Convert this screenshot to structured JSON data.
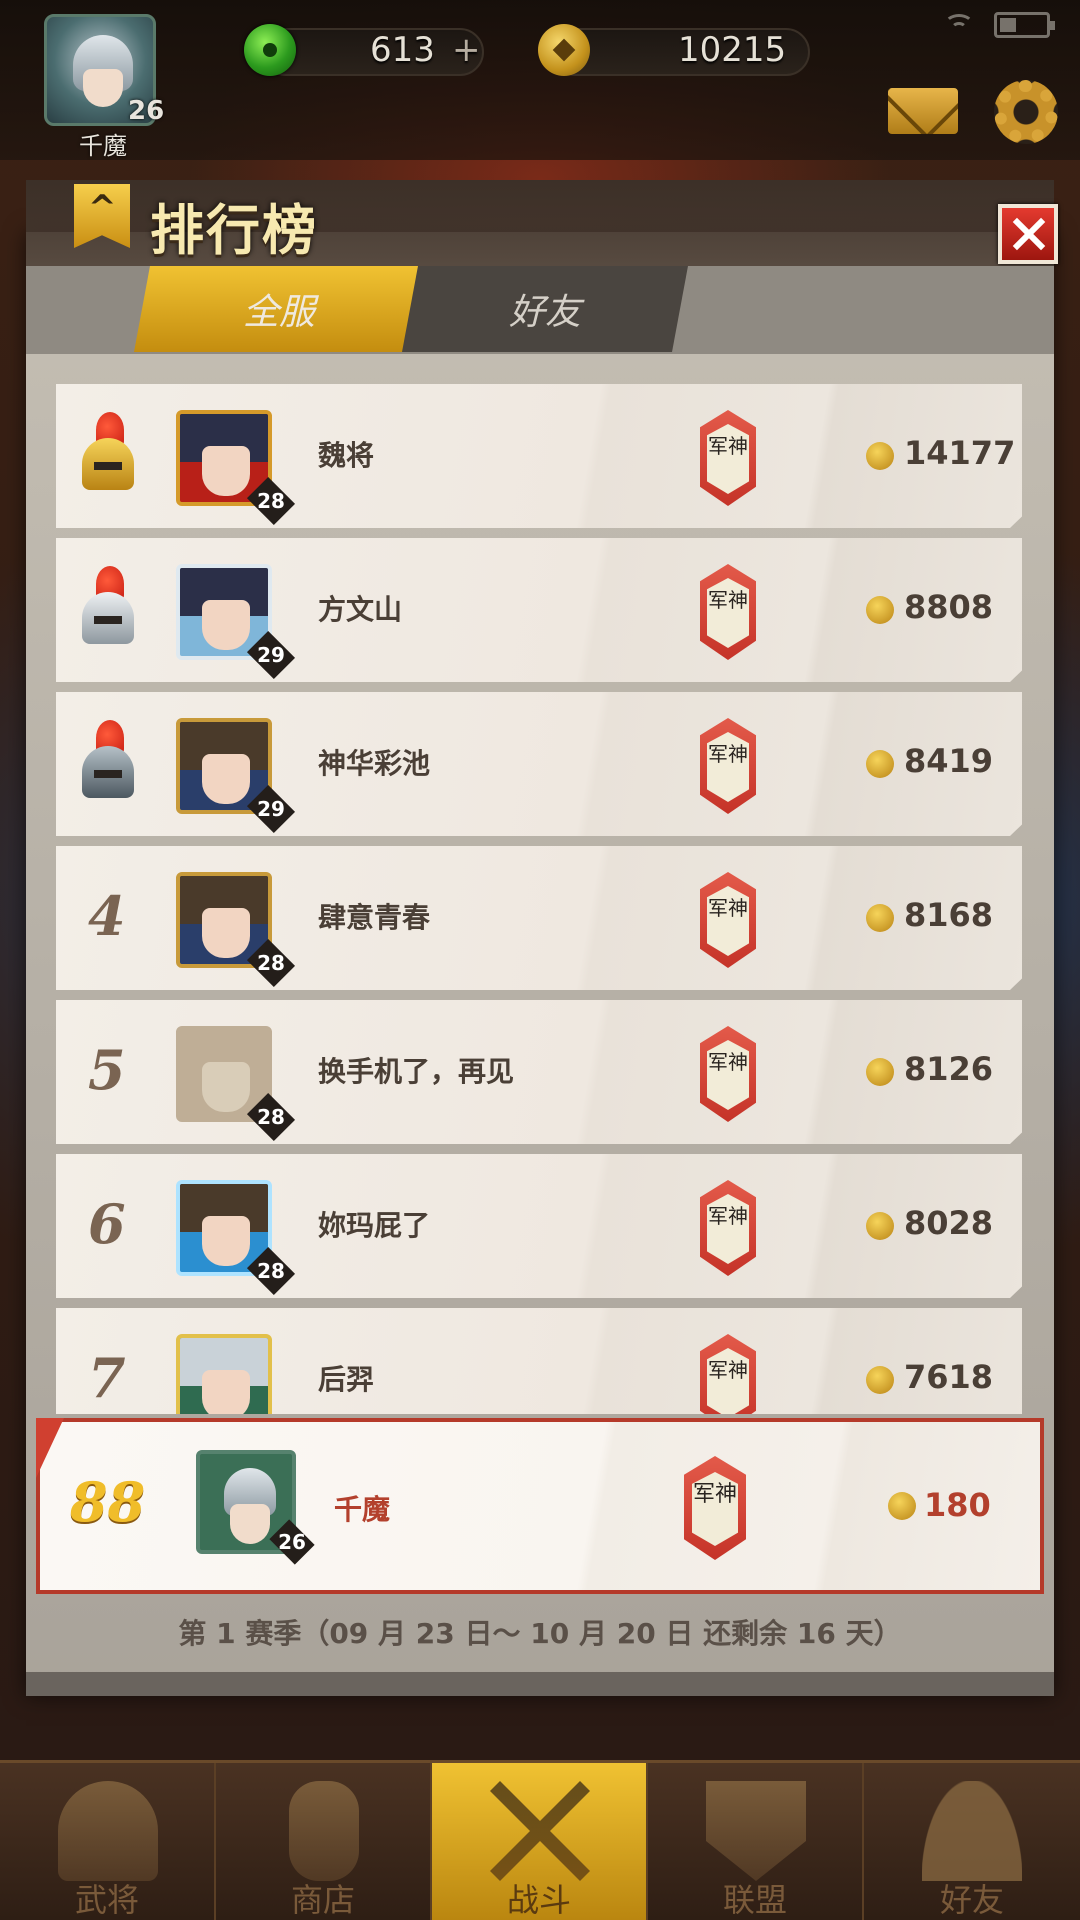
{
  "player": {
    "name": "千魔",
    "level": "26"
  },
  "resources": {
    "jade": "613",
    "jade_plus": "+",
    "coins": "10215"
  },
  "panel": {
    "title": "排行榜",
    "tabs": [
      {
        "label": "全服",
        "active": true
      },
      {
        "label": "好友",
        "active": false
      }
    ],
    "rows": [
      {
        "rank": "1",
        "rank_icon": "gold-helmet-icon",
        "name": "魏将",
        "level": "28",
        "title_badge": "军神",
        "score": "14177"
      },
      {
        "rank": "2",
        "rank_icon": "silver-helmet-icon",
        "name": "方文山",
        "level": "29",
        "title_badge": "军神",
        "score": "8808"
      },
      {
        "rank": "3",
        "rank_icon": "iron-helmet-icon",
        "name": "神华彩池",
        "level": "29",
        "title_badge": "军神",
        "score": "8419"
      },
      {
        "rank": "4",
        "name": "肆意青春",
        "level": "28",
        "title_badge": "军神",
        "score": "8168"
      },
      {
        "rank": "5",
        "name": "换手机了，再见",
        "level": "28",
        "title_badge": "军神",
        "score": "8126"
      },
      {
        "rank": "6",
        "name": "妳玛屁了",
        "level": "28",
        "title_badge": "军神",
        "score": "8028"
      },
      {
        "rank": "7",
        "name": "后羿",
        "level": "",
        "title_badge": "军神",
        "score": "7618"
      }
    ],
    "self_row": {
      "rank": "88",
      "name": "千魔",
      "level": "26",
      "title_badge": "军神",
      "score": "180"
    },
    "season": "第 1 赛季（09 月 23 日～ 10 月 20 日 还剩余 16 天）"
  },
  "nav": [
    {
      "label": "武将",
      "icon": "helmet-icon",
      "active": false
    },
    {
      "label": "商店",
      "icon": "lantern-icon",
      "active": false
    },
    {
      "label": "战斗",
      "icon": "swords-icon",
      "active": true
    },
    {
      "label": "联盟",
      "icon": "shield-icon",
      "active": false
    },
    {
      "label": "好友",
      "icon": "friends-icon",
      "active": false
    }
  ],
  "colors": {
    "accent_gold": "#f0c232",
    "self_highlight": "#b53a2a",
    "text_dark": "#4a3f36"
  }
}
